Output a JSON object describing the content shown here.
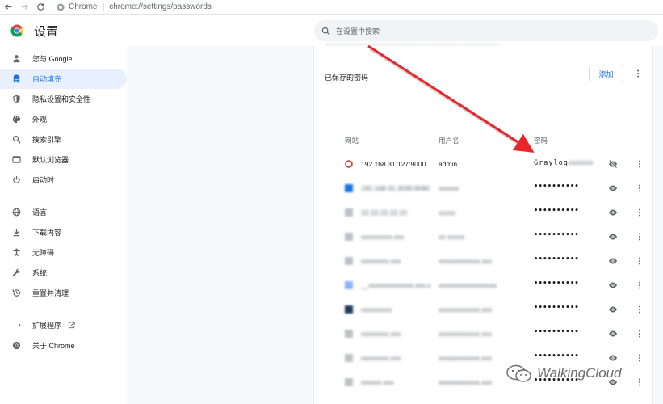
{
  "browser": {
    "site_label": "Chrome",
    "url": "chrome://settings/passwords"
  },
  "header": {
    "title": "设置",
    "search_placeholder": "在设置中搜索"
  },
  "sidebar": {
    "items": [
      {
        "label": "您与 Google",
        "icon": "person-icon"
      },
      {
        "label": "自动填充",
        "icon": "autofill-icon",
        "active": true
      },
      {
        "label": "隐私设置和安全性",
        "icon": "shield-icon"
      },
      {
        "label": "外观",
        "icon": "palette-icon"
      },
      {
        "label": "搜索引擎",
        "icon": "search-icon"
      },
      {
        "label": "默认浏览器",
        "icon": "browser-icon"
      },
      {
        "label": "启动时",
        "icon": "power-icon"
      }
    ],
    "advanced": [
      {
        "label": "语言",
        "icon": "globe-icon"
      },
      {
        "label": "下载内容",
        "icon": "download-icon"
      },
      {
        "label": "无障碍",
        "icon": "accessibility-icon"
      },
      {
        "label": "系统",
        "icon": "wrench-icon"
      },
      {
        "label": "重置并清理",
        "icon": "reset-icon"
      }
    ],
    "extensions_label": "扩展程序",
    "about_label": "关于 Chrome"
  },
  "passwords": {
    "section_title": "已保存的密码",
    "add_label": "添加",
    "columns": {
      "site": "网站",
      "username": "用户名",
      "password": "密码"
    },
    "rows": [
      {
        "site": "192.168.31.127:9000",
        "username": "admin",
        "password": "Graylog",
        "revealed": true
      },
      {
        "site": "",
        "username": "",
        "password": "••••••••••"
      },
      {
        "site": "",
        "username": "",
        "password": "••••••••••"
      },
      {
        "site": "",
        "username": "",
        "password": "••••••••••"
      },
      {
        "site": "",
        "username": "",
        "password": "••••••••••"
      },
      {
        "site": "",
        "username": "",
        "password": "••••••••••"
      },
      {
        "site": "",
        "username": "",
        "password": "••••••••••"
      },
      {
        "site": "",
        "username": "",
        "password": "••••••••••"
      },
      {
        "site": "",
        "username": "",
        "password": "••••••••••"
      },
      {
        "site": "",
        "username": "",
        "password": "••••••••••"
      }
    ]
  },
  "annotation_color": "#e8262a",
  "accent_color": "#1a73e8",
  "watermark": "WalkingCloud"
}
